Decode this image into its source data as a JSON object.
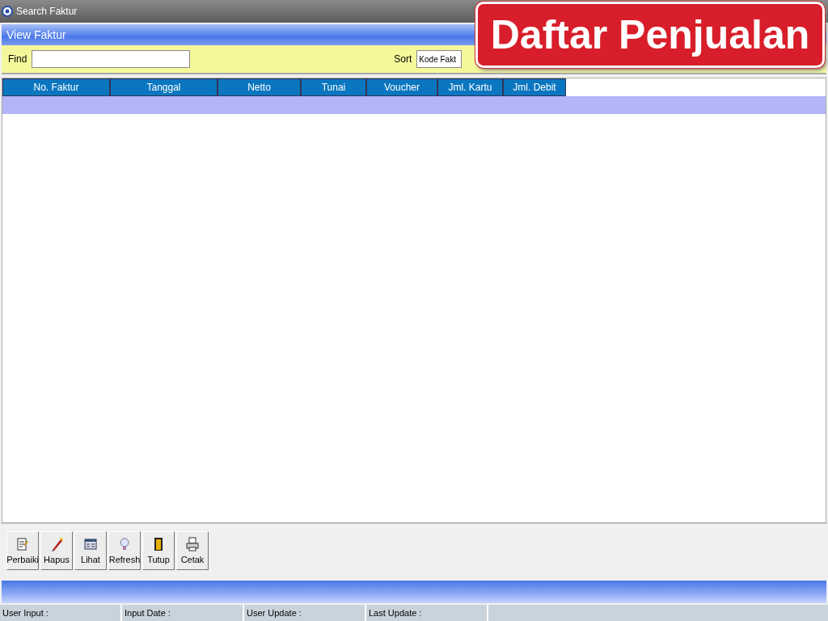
{
  "window": {
    "title": "Search Faktur"
  },
  "banner": "Daftar Penjualan",
  "panel_title": "View Faktur",
  "find": {
    "label": "Find"
  },
  "sort": {
    "label": "Sort",
    "value": "Kode Fakt"
  },
  "table": {
    "columns": [
      "No. Faktur",
      "Tanggal",
      "Netto",
      "Tunai",
      "Voucher",
      "Jml. Kartu",
      "Jml. Debit"
    ],
    "rows": [
      {
        "selected": true,
        "cells": [
          "",
          "",
          "",
          "",
          "",
          "",
          ""
        ]
      }
    ]
  },
  "buttons": [
    {
      "label": "Perbaiki"
    },
    {
      "label": "Hapus"
    },
    {
      "label": "Lihat"
    },
    {
      "label": "Refresh"
    },
    {
      "label": "Tutup"
    },
    {
      "label": "Cetak"
    }
  ],
  "status_bar": [
    "User Input :",
    "Input Date :",
    "User Update :",
    "Last Update :"
  ]
}
